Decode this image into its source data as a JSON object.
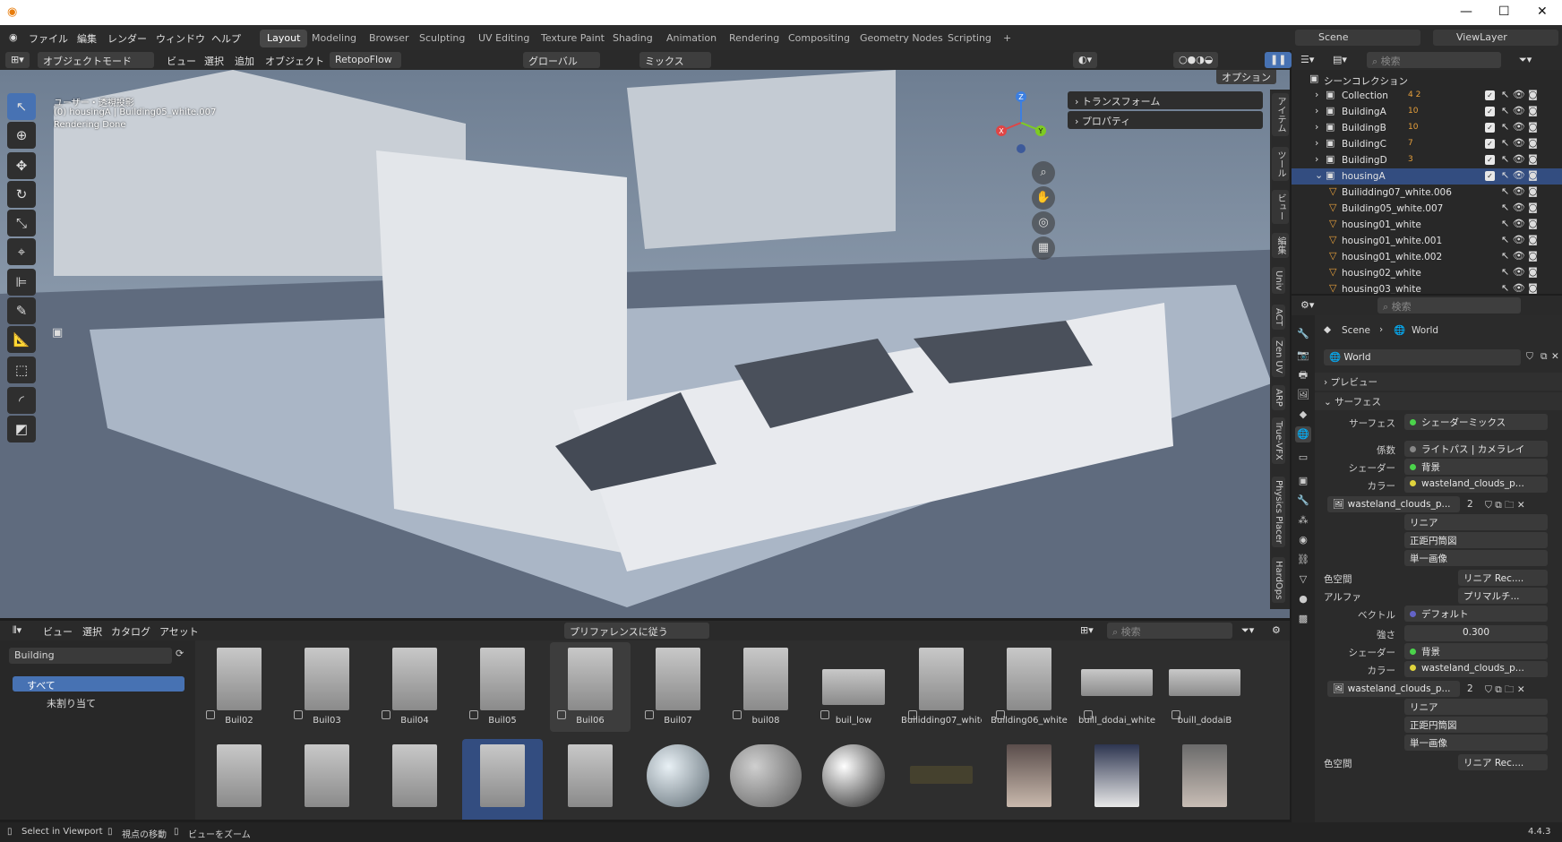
{
  "menubar": {
    "items": [
      "ファイル",
      "編集",
      "レンダー",
      "ウィンドウ",
      "ヘルプ"
    ],
    "workspaces": [
      "Layout",
      "Modeling",
      "Browser",
      "Sculpting",
      "UV Editing",
      "Texture Paint",
      "Shading",
      "Animation",
      "Rendering",
      "Compositing",
      "Geometry Nodes",
      "Scripting"
    ],
    "add": "+"
  },
  "scene_selector": {
    "scene": "Scene",
    "view_layer": "ViewLayer"
  },
  "viewport_header": {
    "mode": "オブジェクトモード",
    "menus": [
      "ビュー",
      "選択",
      "追加",
      "オブジェクト"
    ],
    "addon": "RetopoFlow",
    "transform_orientation": "グローバル",
    "snap": "ミックス",
    "options": "オプション"
  },
  "viewport": {
    "view_name": "ユーザー・透視投影",
    "active": "(0) housingA | Building05_white.007",
    "status": "Rendering Done",
    "npanel": [
      "トランスフォーム",
      "プロパティ"
    ],
    "axes": {
      "x": "X",
      "y": "Y",
      "z": "Z"
    },
    "tabs": [
      "アイテム",
      "ツール",
      "ビュー",
      "編集",
      "Univ",
      "ACT",
      "Zen UV",
      "ARP",
      "True-VFX",
      "Physics Placer",
      "HardOps"
    ]
  },
  "asset_browser": {
    "menus": [
      "ビュー",
      "選択",
      "カタログ",
      "アセット"
    ],
    "import_mode": "プリファレンスに従う",
    "search_placeholder": "検索",
    "library": "Building",
    "catalogs": [
      "すべて",
      "未割り当て"
    ],
    "row1": [
      "Buil02",
      "Buil03",
      "Buil04",
      "Buil05",
      "Buil06",
      "Buil07",
      "buil08",
      "buil_low",
      "Builidding07_white",
      "Building06_white",
      "buill_dodai_white",
      "buill_dodaiB"
    ]
  },
  "outliner": {
    "search_placeholder": "検索",
    "root": "シーンコレクション",
    "rows": [
      {
        "name": "Collection",
        "badge": "4 2"
      },
      {
        "name": "BuildingA",
        "badge": "10"
      },
      {
        "name": "BuildingB",
        "badge": "10"
      },
      {
        "name": "BuildingC",
        "badge": "7"
      },
      {
        "name": "BuildingD",
        "badge": "3"
      },
      {
        "name": "housingA",
        "badge": ""
      },
      {
        "name": "Builidding07_white.006",
        "badge": ""
      },
      {
        "name": "Building05_white.007",
        "badge": ""
      },
      {
        "name": "housing01_white",
        "badge": ""
      },
      {
        "name": "housing01_white.001",
        "badge": ""
      },
      {
        "name": "housing01_white.002",
        "badge": ""
      },
      {
        "name": "housing02_white",
        "badge": ""
      },
      {
        "name": "housing03_white",
        "badge": ""
      }
    ]
  },
  "properties": {
    "search_placeholder": "検索",
    "breadcrumb": [
      "Scene",
      "World"
    ],
    "world": "World",
    "panels": {
      "preview": "プレビュー",
      "surface": "サーフェス"
    },
    "surface_label": "サーフェス",
    "surface_value": "シェーダーミックス",
    "fac_label": "係数",
    "fac_value": "ライトパス | カメラレイ",
    "shader_label": "シェーダー",
    "shader_value": "背景",
    "color_label": "カラー",
    "color_value": "wasteland_clouds_p...",
    "image_name": "wasteland_clouds_p...",
    "users": "2",
    "interp": "リニア",
    "projection": "正距円筒図",
    "source": "単一画像",
    "colorspace_label": "色空間",
    "colorspace_value": "リニア Rec....",
    "alpha_label": "アルファ",
    "alpha_value": "プリマルチ...",
    "vector_label": "ベクトル",
    "vector_value": "デフォルト",
    "strength_label": "強さ",
    "strength_value": "0.300",
    "shader2_value": "背景",
    "color2_value": "wasteland_clouds_p...",
    "image2_name": "wasteland_clouds_p...",
    "users2": "2",
    "interp2": "リニア",
    "projection2": "正距円筒図",
    "source2": "単一画像",
    "colorspace2_value": "リニア Rec...."
  },
  "statusbar": {
    "items": [
      "Select in Viewport",
      "視点の移動",
      "ビューをズーム"
    ],
    "version": "4.4.3"
  },
  "colors": {
    "accent": "#4772b3",
    "highlight": "#334d80",
    "panel": "#2b2b2b"
  }
}
